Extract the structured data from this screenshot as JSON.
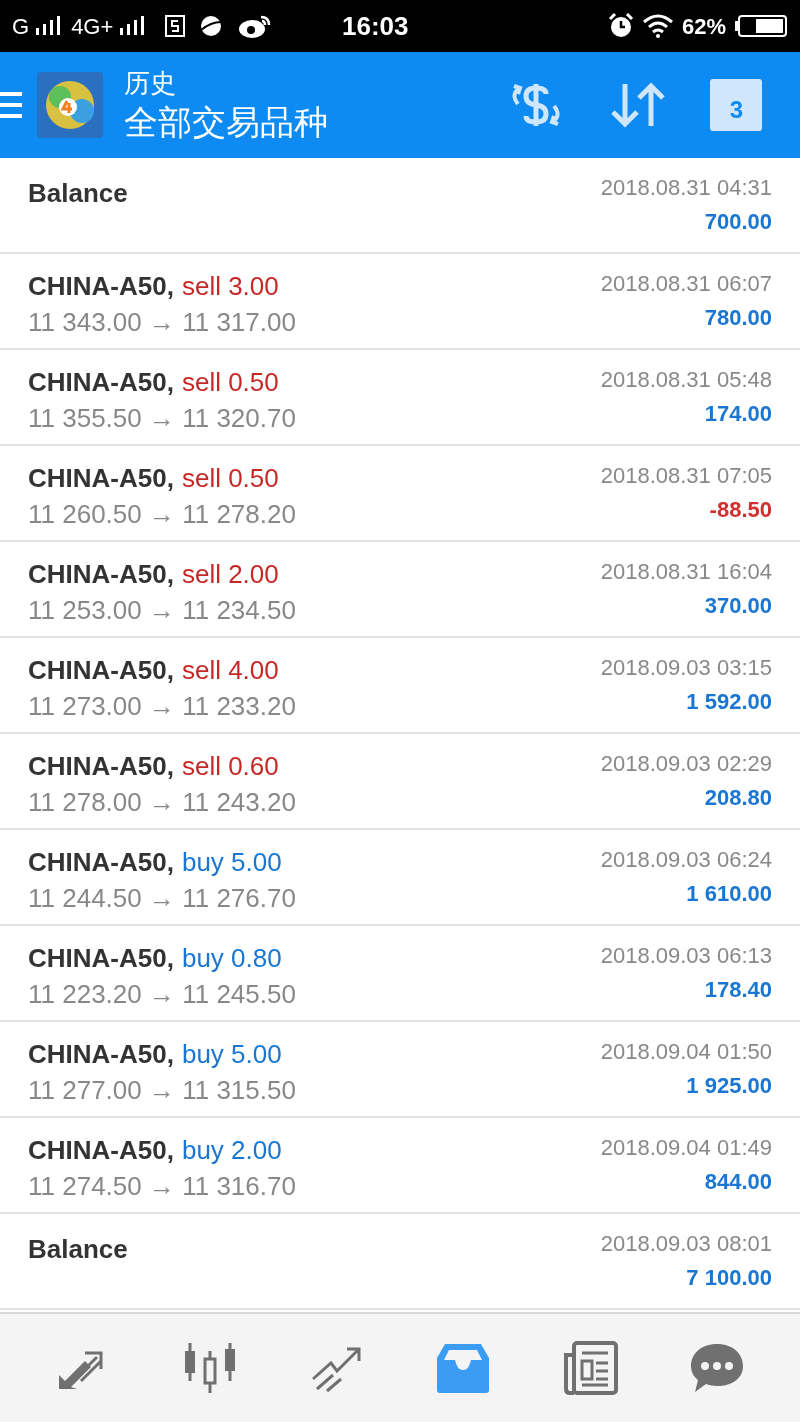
{
  "status_bar": {
    "network_1": "G",
    "network_2": "4G+",
    "time": "16:03",
    "battery": "62%"
  },
  "header": {
    "title": "历史",
    "subtitle": "全部交易品种",
    "calendar_day": "3"
  },
  "rows": [
    {
      "kind": "balance",
      "label": "Balance",
      "time": "2018.08.31 04:31",
      "amount": "700.00",
      "negative": false
    },
    {
      "kind": "sell",
      "symbol": "CHINA-A50,",
      "order": "sell 3.00",
      "prices": "11 343.00 → 11 317.00",
      "time": "2018.08.31 06:07",
      "amount": "780.00",
      "negative": false
    },
    {
      "kind": "sell",
      "symbol": "CHINA-A50,",
      "order": "sell 0.50",
      "prices": "11 355.50 → 11 320.70",
      "time": "2018.08.31 05:48",
      "amount": "174.00",
      "negative": false
    },
    {
      "kind": "sell",
      "symbol": "CHINA-A50,",
      "order": "sell 0.50",
      "prices": "11 260.50 → 11 278.20",
      "time": "2018.08.31 07:05",
      "amount": "-88.50",
      "negative": true
    },
    {
      "kind": "sell",
      "symbol": "CHINA-A50,",
      "order": "sell 2.00",
      "prices": "11 253.00 → 11 234.50",
      "time": "2018.08.31 16:04",
      "amount": "370.00",
      "negative": false
    },
    {
      "kind": "sell",
      "symbol": "CHINA-A50,",
      "order": "sell 4.00",
      "prices": "11 273.00 → 11 233.20",
      "time": "2018.09.03 03:15",
      "amount": "1 592.00",
      "negative": false
    },
    {
      "kind": "sell",
      "symbol": "CHINA-A50,",
      "order": "sell 0.60",
      "prices": "11 278.00 → 11 243.20",
      "time": "2018.09.03 02:29",
      "amount": "208.80",
      "negative": false
    },
    {
      "kind": "buy",
      "symbol": "CHINA-A50,",
      "order": "buy 5.00",
      "prices": "11 244.50 → 11 276.70",
      "time": "2018.09.03 06:24",
      "amount": "1 610.00",
      "negative": false
    },
    {
      "kind": "buy",
      "symbol": "CHINA-A50,",
      "order": "buy 0.80",
      "prices": "11 223.20 → 11 245.50",
      "time": "2018.09.03 06:13",
      "amount": "178.40",
      "negative": false
    },
    {
      "kind": "buy",
      "symbol": "CHINA-A50,",
      "order": "buy 5.00",
      "prices": "11 277.00 → 11 315.50",
      "time": "2018.09.04 01:50",
      "amount": "1 925.00",
      "negative": false
    },
    {
      "kind": "buy",
      "symbol": "CHINA-A50,",
      "order": "buy 2.00",
      "prices": "11 274.50 → 11 316.70",
      "time": "2018.09.04 01:49",
      "amount": "844.00",
      "negative": false
    },
    {
      "kind": "balance",
      "label": "Balance",
      "time": "2018.09.03 08:01",
      "amount": "7 100.00",
      "negative": false
    }
  ],
  "nav": [
    {
      "kind": "trade",
      "selected": false
    },
    {
      "kind": "chart",
      "selected": false
    },
    {
      "kind": "trend",
      "selected": false
    },
    {
      "kind": "history",
      "selected": true
    },
    {
      "kind": "news",
      "selected": false
    },
    {
      "kind": "chat",
      "selected": false
    }
  ]
}
